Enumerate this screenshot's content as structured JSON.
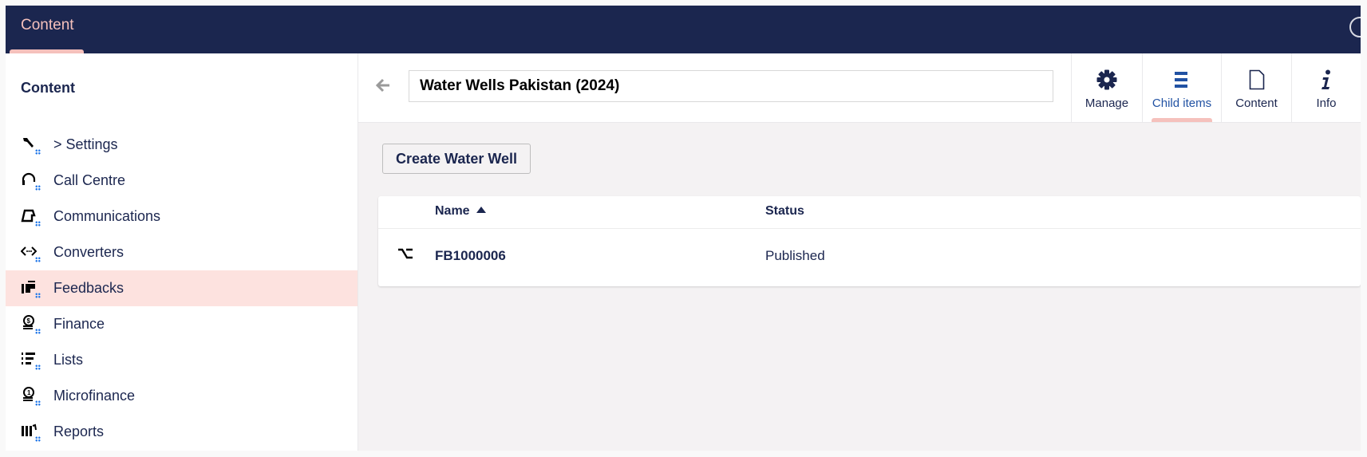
{
  "header": {
    "tabs": [
      {
        "label": "Content",
        "active": true
      }
    ],
    "accent_color": "#f5c1bc",
    "bar_color": "#1b264f",
    "right_icon": "help-icon"
  },
  "sidebar": {
    "title": "Content",
    "items": [
      {
        "label": "> Settings",
        "icon": "wrench-icon",
        "glyph": "🔧"
      },
      {
        "label": "Call Centre",
        "icon": "headset-icon",
        "glyph": "🎧"
      },
      {
        "label": "Communications",
        "icon": "communications-icon",
        "glyph": "⌂"
      },
      {
        "label": "Converters",
        "icon": "code-arrows-icon",
        "glyph": "‹›"
      },
      {
        "label": "Feedbacks",
        "icon": "feedback-icon",
        "glyph": "▙",
        "active": true
      },
      {
        "label": "Finance",
        "icon": "coins-dollar-icon",
        "glyph": "$"
      },
      {
        "label": "Lists",
        "icon": "numbered-list-icon",
        "glyph": "☰"
      },
      {
        "label": "Microfinance",
        "icon": "coins-one-icon",
        "glyph": "①"
      },
      {
        "label": "Reports",
        "icon": "books-icon",
        "glyph": "▥"
      }
    ]
  },
  "content": {
    "node_name": "Water Wells Pakistan (2024)",
    "back_icon": "arrow-left-icon",
    "apps": [
      {
        "label": "Manage",
        "icon": "gear-icon"
      },
      {
        "label": "Child items",
        "icon": "list-icon",
        "active": true
      },
      {
        "label": "Content",
        "icon": "document-icon"
      },
      {
        "label": "Info",
        "icon": "info-icon"
      }
    ],
    "create_button": "Create Water Well",
    "table": {
      "columns": [
        {
          "label": "Name",
          "sort": "ascending"
        },
        {
          "label": "Status"
        }
      ],
      "rows": [
        {
          "icon": "option-icon",
          "name": "FB1000006",
          "status": "Published"
        }
      ]
    }
  }
}
